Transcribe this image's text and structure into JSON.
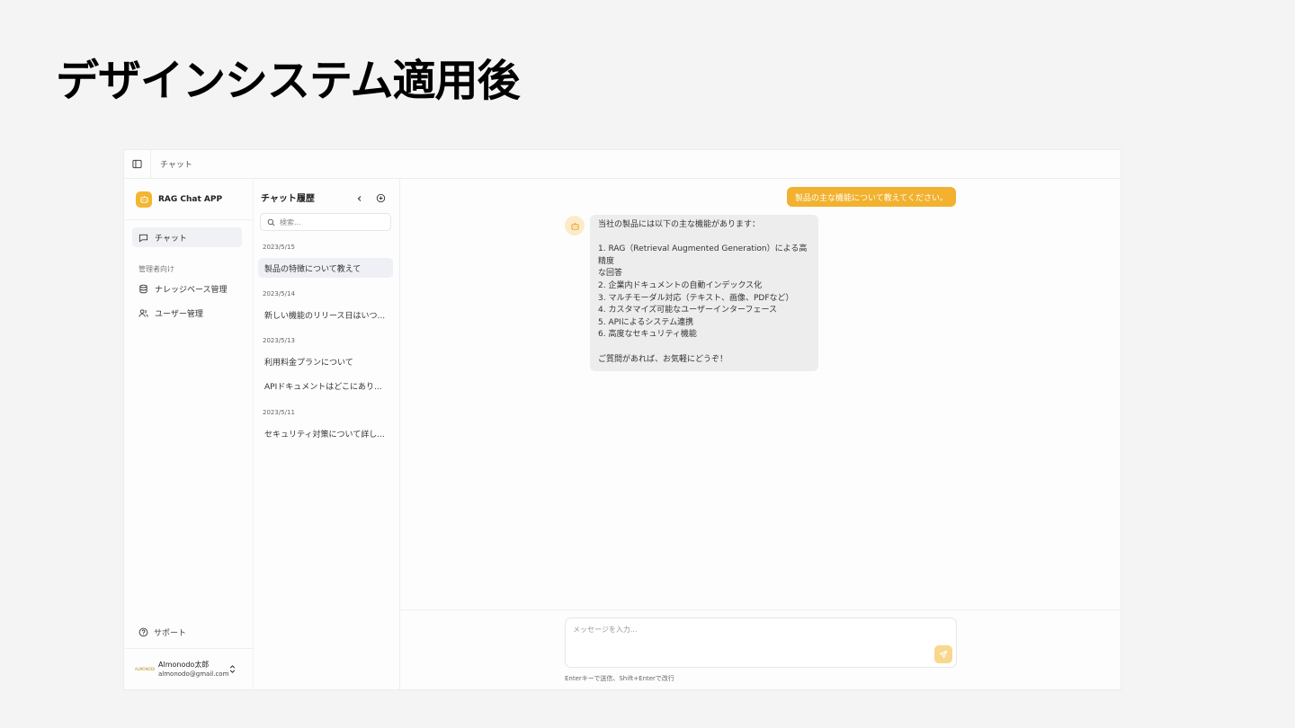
{
  "slide": {
    "title": "デザインシステム適用後"
  },
  "topbar": {
    "breadcrumb": "チャット",
    "sidebar_toggle_icon": "panel-left-icon"
  },
  "sidebar": {
    "app_name": "RAG Chat APP",
    "logo_icon": "bot-icon",
    "nav": [
      {
        "label": "チャット",
        "icon": "message-square-icon",
        "active": true
      }
    ],
    "admin_section_label": "管理者向け",
    "admin_nav": [
      {
        "label": "ナレッジベース管理",
        "icon": "database-icon"
      },
      {
        "label": "ユーザー管理",
        "icon": "users-icon"
      }
    ],
    "support_label": "サポート",
    "user": {
      "name": "Almonodo太郎",
      "email": "almonodo@gmail.com",
      "avatar_text": "ALMONODO"
    }
  },
  "history": {
    "title": "チャット履歴",
    "search_placeholder": "検索...",
    "groups": [
      {
        "date": "2023/5/15",
        "items": [
          "製品の特徴について教えて"
        ]
      },
      {
        "date": "2023/5/14",
        "items": [
          "新しい機能のリリース日はいつ..."
        ]
      },
      {
        "date": "2023/5/13",
        "items": [
          "利用料金プランについて",
          "APIドキュメントはどこにあり..."
        ]
      },
      {
        "date": "2023/5/11",
        "items": [
          "セキュリティ対策について詳し..."
        ]
      }
    ]
  },
  "chat": {
    "user_message": "製品の主な機能について教えてください。",
    "bot_lines": [
      "当社の製品には以下の主な機能があります：",
      "",
      "1. RAG（Retrieval Augmented Generation）による高精度",
      "な回答",
      "2. 企業内ドキュメントの自動インデックス化",
      "3. マルチモーダル対応（テキスト、画像、PDFなど）",
      "4. カスタマイズ可能なユーザーインターフェース",
      "5. APIによるシステム連携",
      "6. 高度なセキュリティ機能",
      "",
      "ご質問があれば、お気軽にどうぞ！"
    ],
    "input_placeholder": "メッセージを入力...",
    "hint": "Enterキーで送信、Shift+Enterで改行"
  },
  "colors": {
    "accent": "#f2b12e",
    "background": "#f4f4f4"
  }
}
